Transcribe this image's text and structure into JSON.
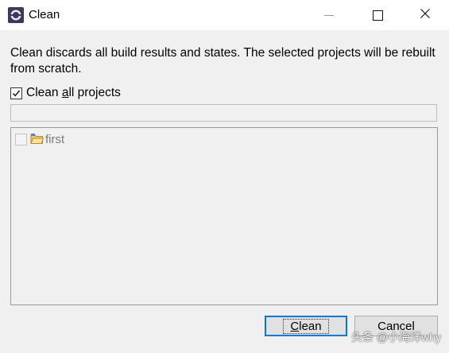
{
  "window": {
    "title": "Clean",
    "controls": [
      "minimize-icon",
      "maximize-icon",
      "close-icon"
    ]
  },
  "dialog": {
    "description": "Clean discards all build results and states. The selected projects will be rebuilt from scratch.",
    "clean_all": {
      "label_prefix": "Clean ",
      "label_mnemonic": "a",
      "label_suffix": "ll projects",
      "checked": true
    },
    "filter": {
      "value": ""
    },
    "projects": [
      {
        "name": "first",
        "checked": false,
        "enabled": false,
        "icon": "project-folder-icon"
      }
    ]
  },
  "buttons": {
    "clean_mnemonic": "C",
    "clean_rest": "lean",
    "cancel": "Cancel"
  },
  "watermark": "头条 @小海洋why",
  "colors": {
    "dialog_bg": "#f0f0f0",
    "titlebar_bg": "#ffffff",
    "default_button_border": "#0078d7",
    "disabled_text": "#7a7a7a"
  }
}
